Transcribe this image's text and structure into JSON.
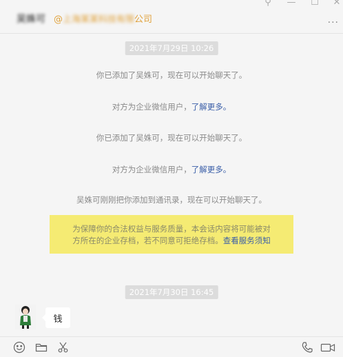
{
  "header": {
    "contact_name": "吴姝可",
    "company_blurred": "上海某某科技有限",
    "company_suffix": "公司",
    "more_label": "···"
  },
  "window_controls": {
    "pin": "⚲",
    "minimize": "—",
    "maximize": "☐",
    "close": "✕"
  },
  "messages": {
    "timestamp_1": "2021年7月29日 10:26",
    "sys_1": "你已添加了吴姝可，现在可以开始聊天了。",
    "sys_2_text": "对方为企业微信用户，",
    "sys_2_link": "了解更多。",
    "sys_3": "你已添加了吴姝可，现在可以开始聊天了。",
    "sys_4_text": "对方为企业微信用户，",
    "sys_4_link": "了解更多。",
    "sys_5": "吴姝可刚刚把你添加到通讯录，现在可以开始聊天了。",
    "notice_line1": "为保障你的合法权益与服务质量，本会话内容将可能被对",
    "notice_line2": "方所在的企业存档，若不同意可拒绝存档。",
    "notice_link": "查看服务须知",
    "timestamp_2": "2021年7月30日 16:45",
    "chat_bubble": "钱"
  },
  "colors": {
    "accent_company": "#e0a13a",
    "link": "#3a5ea8",
    "notice_bg": "#f5eb73",
    "background": "#f5f5f5"
  },
  "toolbar": {
    "left_icons": [
      "emoji-icon",
      "folder-icon",
      "scissors-icon"
    ],
    "right_icons": [
      "phone-icon",
      "video-icon"
    ]
  }
}
